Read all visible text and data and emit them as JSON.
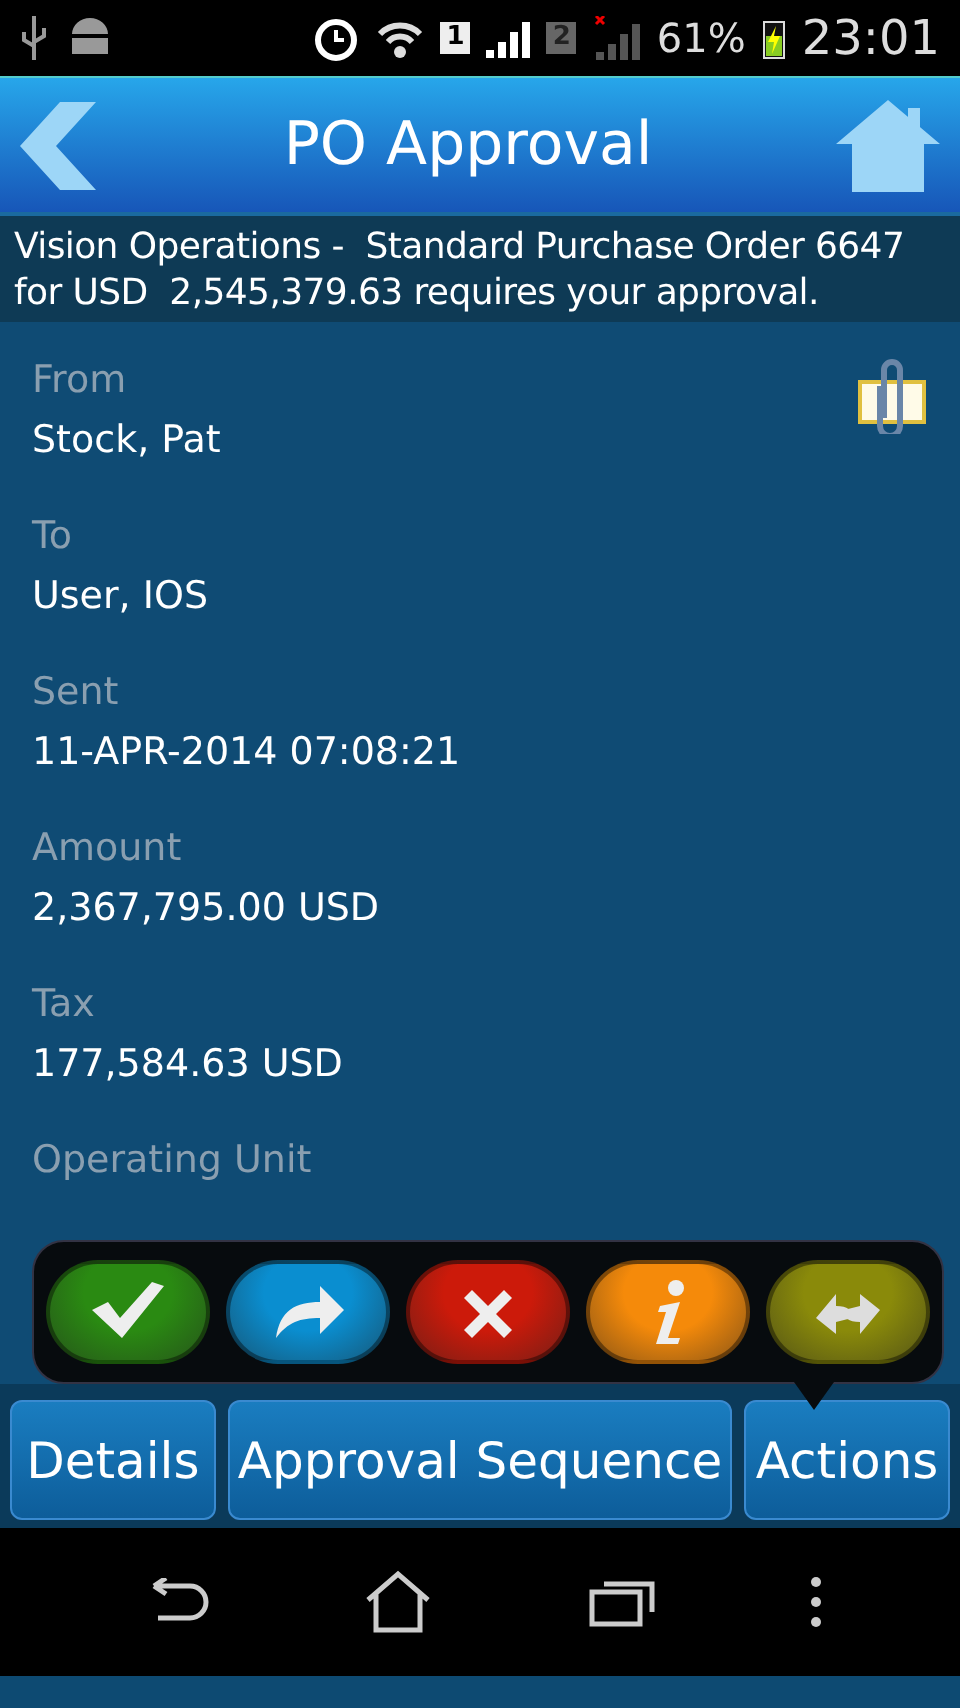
{
  "status_bar": {
    "sim_1": "1",
    "sim_2": "2",
    "battery": "61%",
    "time": "23:01"
  },
  "header": {
    "title": "PO Approval"
  },
  "notification": {
    "text": "Vision Operations -  Standard Purchase Order 6647  for USD  2,545,379.63 requires your approval."
  },
  "fields": [
    {
      "label": "From",
      "value": "Stock, Pat"
    },
    {
      "label": "To",
      "value": "User, IOS"
    },
    {
      "label": "Sent",
      "value": "11-APR-2014 07:08:21"
    },
    {
      "label": "Amount",
      "value": "2,367,795.00 USD"
    },
    {
      "label": "Tax",
      "value": "177,584.63 USD"
    },
    {
      "label": "Operating Unit"
    }
  ],
  "action_popup": {
    "actions": [
      {
        "kind": "approve",
        "color": "#2a8a12"
      },
      {
        "kind": "forward",
        "color": "#0a8ed0"
      },
      {
        "kind": "reject",
        "color": "#cc1a0a"
      },
      {
        "kind": "info",
        "color": "#f58a0a"
      },
      {
        "kind": "reassign",
        "color": "#8a8a0a"
      }
    ]
  },
  "tabs": [
    {
      "label": "Details"
    },
    {
      "label": "Approval Sequence"
    },
    {
      "label": "Actions"
    }
  ]
}
